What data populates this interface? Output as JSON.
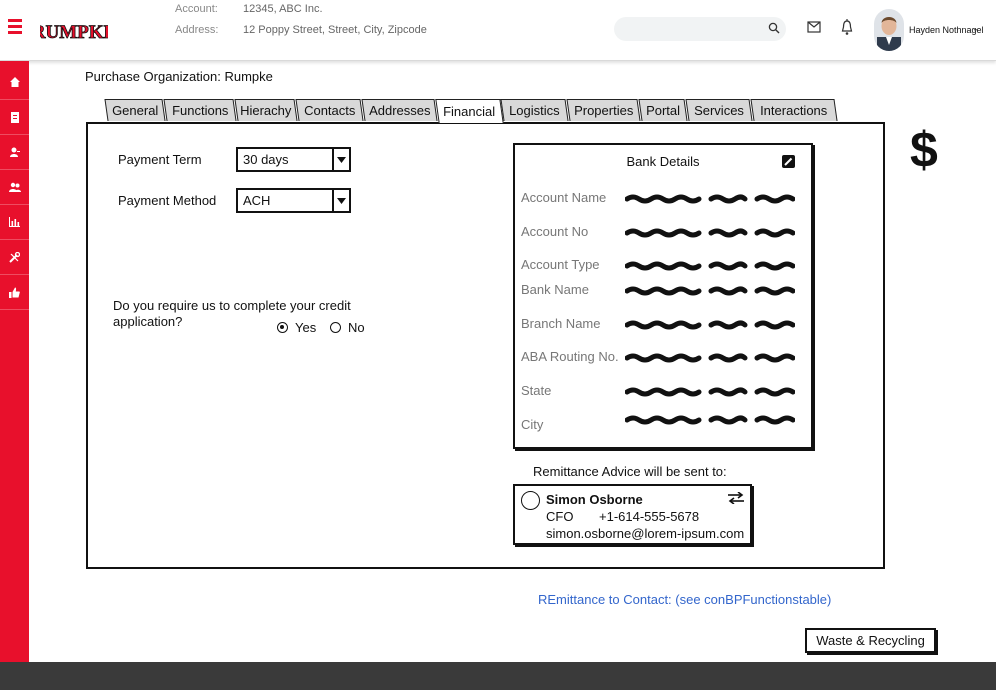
{
  "header": {
    "logo_text": "RUMPKE",
    "account_label": "Account:",
    "account_value": "12345, ABC Inc.",
    "address_label": "Address:",
    "address_value": "12 Poppy Street, Street, City, Zipcode",
    "user_name": "Hayden Nothnagel",
    "icons": [
      "menu-icon",
      "search-icon",
      "mail-icon",
      "notification-icon",
      "chevron-down-icon"
    ]
  },
  "sidebar": {
    "items": [
      {
        "icon": "home-icon"
      },
      {
        "icon": "document-icon"
      },
      {
        "icon": "user-icon"
      },
      {
        "icon": "users-icon"
      },
      {
        "icon": "chart-icon"
      },
      {
        "icon": "tools-icon"
      },
      {
        "icon": "thumbs-up-icon"
      }
    ]
  },
  "page": {
    "org_label": "Purchase Organization:",
    "org_value": "Rumpke"
  },
  "tabs": [
    {
      "label": "General",
      "active": false
    },
    {
      "label": "Functions",
      "active": false
    },
    {
      "label": "Hierachy",
      "active": false
    },
    {
      "label": "Contacts",
      "active": false
    },
    {
      "label": "Addresses",
      "active": false
    },
    {
      "label": "Financial",
      "active": true
    },
    {
      "label": "Logistics",
      "active": false
    },
    {
      "label": "Properties",
      "active": false
    },
    {
      "label": "Portal",
      "active": false
    },
    {
      "label": "Services",
      "active": false
    },
    {
      "label": "Interactions",
      "active": false
    }
  ],
  "financial": {
    "currency_symbol": "$",
    "payment_term_label": "Payment Term",
    "payment_term_value": "30 days",
    "payment_method_label": "Payment Method",
    "payment_method_value": "ACH",
    "credit_question": "Do you require us to complete your credit application?",
    "yes_label": "Yes",
    "no_label": "No",
    "selected": "Yes"
  },
  "bank": {
    "title": "Bank Details",
    "fields": [
      "Account Name",
      "Account No",
      "Account Type",
      "Bank Name",
      "Branch Name",
      "ABA Routing No.",
      "State",
      "City"
    ]
  },
  "remittance": {
    "label": "Remittance Advice will be sent to:",
    "contact_name": "Simon Osborne",
    "contact_role": "CFO",
    "contact_phone": "+1-614-555-5678",
    "contact_email": "simon.osborne@lorem-ipsum.com",
    "link_text": "REmittance to Contact: (see conBPFunctionstable)"
  },
  "footer_button": "Waste & Recycling",
  "colors": {
    "brand_red": "#e8102c",
    "link_blue": "#3366cc",
    "footer": "#3a3a3a"
  }
}
